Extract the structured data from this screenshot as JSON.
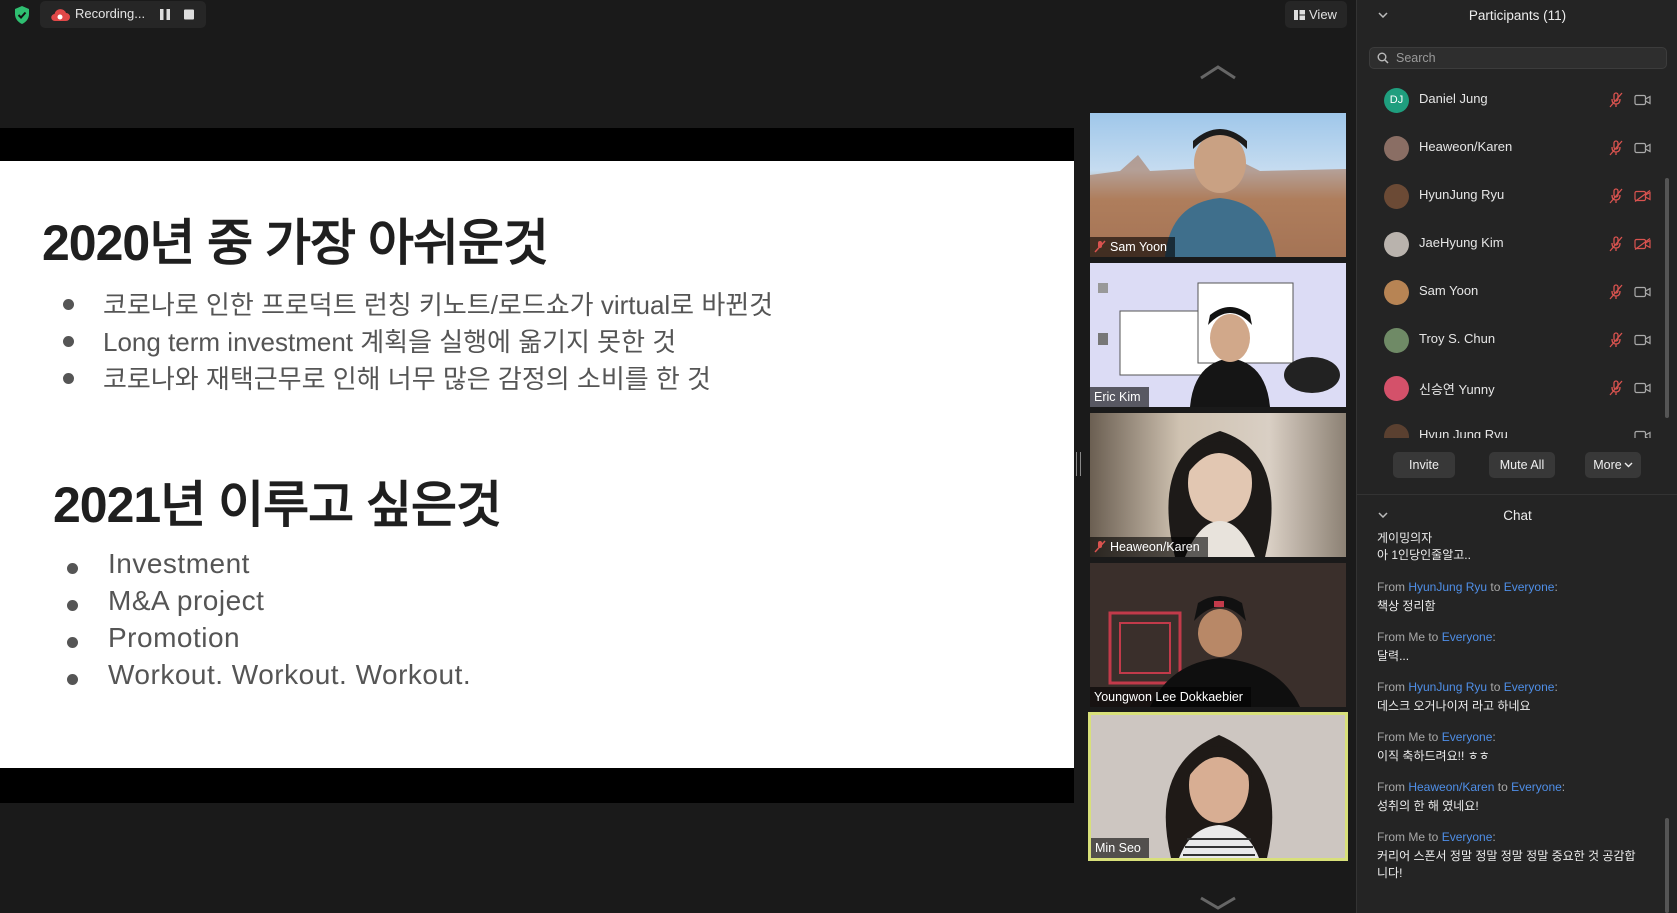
{
  "recording": {
    "label": "Recording..."
  },
  "view_button": {
    "label": "View"
  },
  "slide": {
    "heading1": "2020년 중 가장 아쉬운것",
    "list1": [
      "코로나로 인한 프로덕트 런칭 키노트/로드쇼가 virtual로 바뀐것",
      "Long term investment 계획을 실행에 옮기지 못한 것",
      "코로나와 재택근무로 인해 너무 많은 감정의 소비를 한 것"
    ],
    "heading2": "2021년 이루고 싶은것",
    "list2": [
      "Investment",
      "M&A project",
      "Promotion",
      "Workout. Workout. Workout."
    ]
  },
  "videos": [
    {
      "name": "Sam Yoon",
      "muted": true
    },
    {
      "name": "Eric Kim",
      "muted": false
    },
    {
      "name": "Heaweon/Karen",
      "muted": true
    },
    {
      "name": "Youngwon Lee Dokkaebier",
      "muted": false
    },
    {
      "name": "Min Seo",
      "muted": false,
      "active_speaker": true
    }
  ],
  "participants": {
    "title": "Participants (11)",
    "search_placeholder": "Search",
    "list": [
      {
        "name": "Daniel Jung",
        "initials": "DJ",
        "avatar_color": "#1f9e7e",
        "mic_muted": true,
        "video_off": false
      },
      {
        "name": "Heaweon/Karen",
        "initials": "",
        "avatar_color": "#8a6e64",
        "mic_muted": true,
        "video_off": false
      },
      {
        "name": "HyunJung Ryu",
        "initials": "",
        "avatar_color": "#6b4a35",
        "mic_muted": true,
        "video_off": true
      },
      {
        "name": "JaeHyung Kim",
        "initials": "",
        "avatar_color": "#b9b3ad",
        "mic_muted": true,
        "video_off": true
      },
      {
        "name": "Sam Yoon",
        "initials": "",
        "avatar_color": "#b78454",
        "mic_muted": true,
        "video_off": false
      },
      {
        "name": "Troy S. Chun",
        "initials": "",
        "avatar_color": "#6f8a66",
        "mic_muted": true,
        "video_off": false
      },
      {
        "name": "신승연 Yunny",
        "initials": "",
        "avatar_color": "#d4516a",
        "mic_muted": true,
        "video_off": false
      },
      {
        "name": "Hyun Jung Ryu",
        "initials": "",
        "avatar_color": "#5a4030",
        "mic_muted": false,
        "video_off": false
      }
    ],
    "buttons": {
      "invite": "Invite",
      "mute_all": "Mute All",
      "more": "More"
    }
  },
  "chat": {
    "title": "Chat",
    "partial_lines": [
      "게이밍의자",
      "아 1인당인줄알고.."
    ],
    "messages": [
      {
        "prefix": "From ",
        "sender": "HyunJung Ryu",
        "sender_is_link": true,
        "mid": " to ",
        "recipient": "Everyone",
        "text": "책상 정리함"
      },
      {
        "prefix": "From ",
        "sender": "Me",
        "sender_is_link": false,
        "mid": " to ",
        "recipient": "Everyone",
        "text": "달력..."
      },
      {
        "prefix": "From ",
        "sender": "HyunJung Ryu",
        "sender_is_link": true,
        "mid": " to ",
        "recipient": "Everyone",
        "text": "데스크 오거나이저 라고 하네요"
      },
      {
        "prefix": "From ",
        "sender": "Me",
        "sender_is_link": false,
        "mid": " to ",
        "recipient": "Everyone",
        "text": "이직 축하드려요!! ㅎㅎ"
      },
      {
        "prefix": "From ",
        "sender": "Heaweon/Karen",
        "sender_is_link": true,
        "mid": " to ",
        "recipient": "Everyone",
        "text": "성취의 한 해 였네요!"
      },
      {
        "prefix": "From ",
        "sender": "Me",
        "sender_is_link": false,
        "mid": " to ",
        "recipient": "Everyone",
        "text": "커리어 스폰서 정말 정말 정말 정말 중요한 것 공감합니다!"
      }
    ]
  },
  "colors": {
    "accent_link": "#4f8fe8",
    "mute_red": "#d9534f",
    "active_speaker_border": "#d8e07a",
    "shield_green": "#2fbf71"
  }
}
